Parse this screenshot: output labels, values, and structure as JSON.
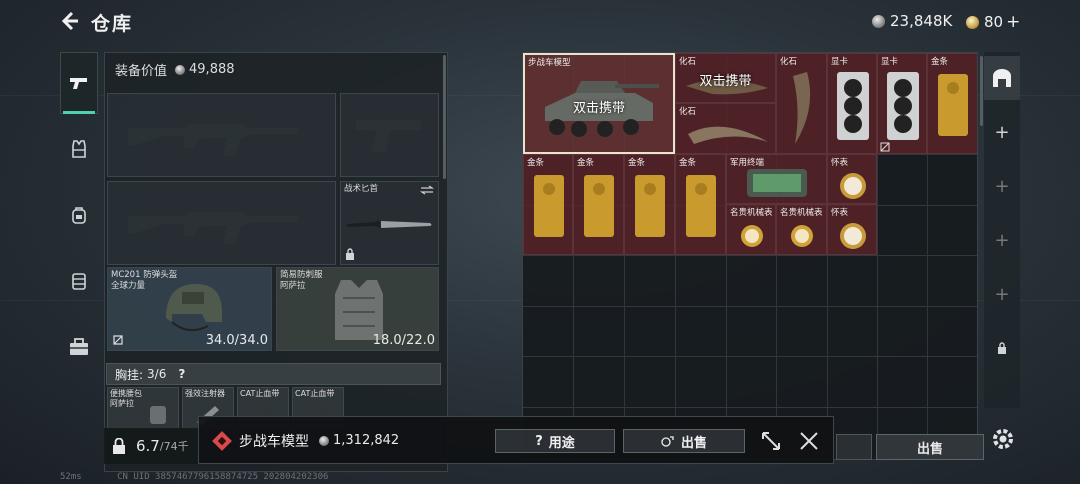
{
  "header": {
    "title": "仓库",
    "currency_coins": "23,848K",
    "currency_premium": "80",
    "currency_add": "+"
  },
  "nav": {
    "items": [
      "weapon-icon",
      "armor-icon",
      "backpack-icon",
      "chest-rig-icon",
      "toolbox-icon"
    ]
  },
  "equipment": {
    "value_label": "装备价值",
    "value": "49,888",
    "knife_name": "战术匕首",
    "helmet_name": "MC201 防弹头盔",
    "helmet_sub": "全球力量",
    "helmet_durability": "34.0/34.0",
    "armor_name": "简易防刺服",
    "armor_sub": "阿萨拉",
    "armor_durability": "18.0/22.0",
    "chest_label": "胸挂:",
    "chest_capacity": "3/6",
    "chest_help": "?",
    "chest_items": [
      {
        "name": "便携腰包",
        "sub": "阿萨拉"
      },
      {
        "name": "强效注射器"
      },
      {
        "name": "CAT止血带"
      },
      {
        "name": "CAT止血带"
      }
    ]
  },
  "capacity": {
    "current": "6.7",
    "max": "/74千"
  },
  "storage": {
    "carry_label": "双击携带",
    "items": {
      "ifv": "步战车模型",
      "fossil1": "化石",
      "fossil2": "化石",
      "fossil3": "化石",
      "gpu1": "显卡",
      "gpu2": "显卡",
      "gold": "金条",
      "ammo_box": "军用终端",
      "pocket_watch": "怀表",
      "luxury_watch": "名贵机械表"
    }
  },
  "detail": {
    "name": "步战车模型",
    "price": "1,312,842",
    "use_label": "用途",
    "use_help": "?",
    "sell_label": "出售"
  },
  "sell_button": "出售",
  "debug": {
    "fps": "52ms",
    "uid": "CN UID 3857467796158874725 202804202306"
  },
  "colors": {
    "accent": "#4fd1b0",
    "item_bg": "#5c2228",
    "selected_border": "#e8e2cf",
    "detail_icon": "#d94a4a"
  }
}
